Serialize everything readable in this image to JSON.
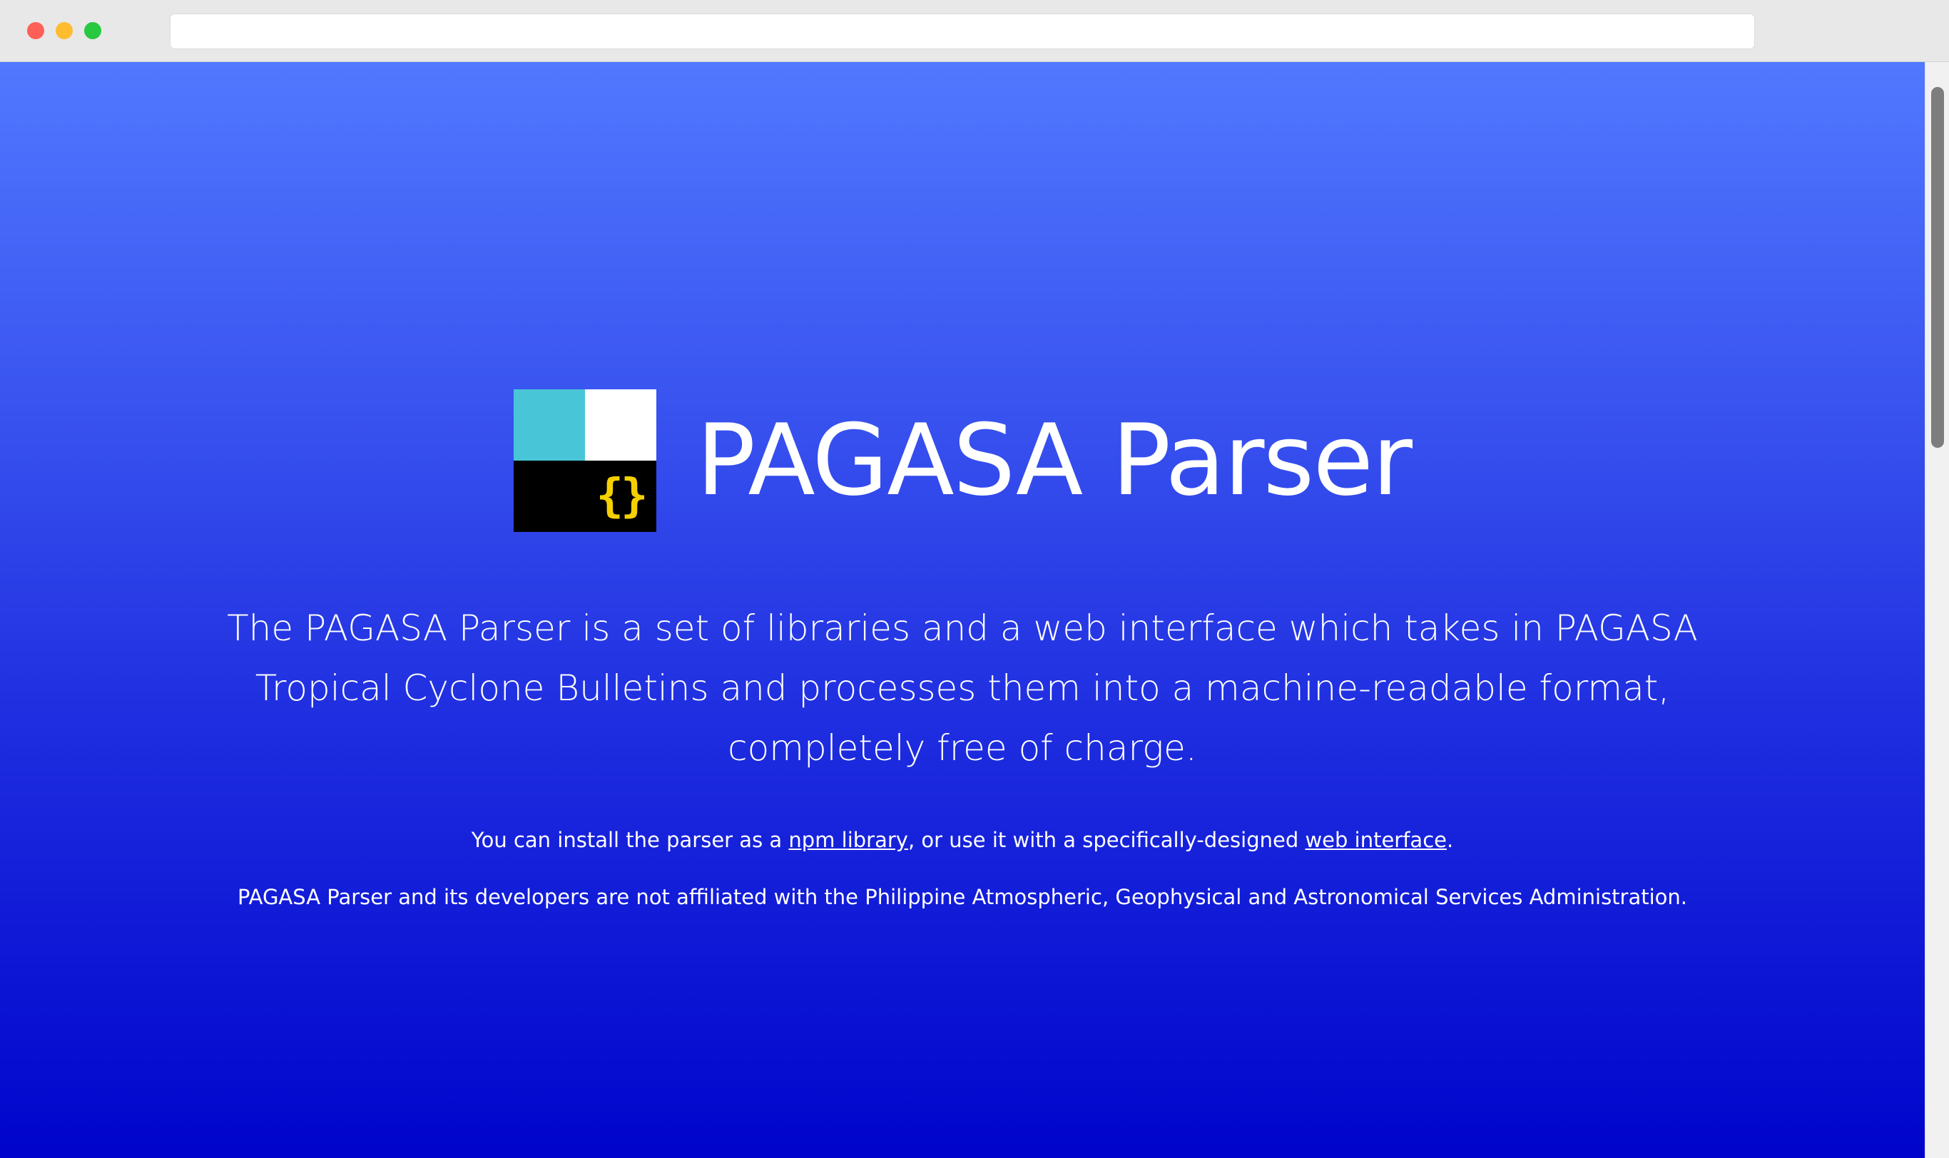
{
  "browser": {
    "address_value": ""
  },
  "hero": {
    "logo_glyph": "{}",
    "title": "PAGASA Parser"
  },
  "content": {
    "description": "The PAGASA Parser is a set of libraries and a web interface which takes in PAGASA Tropical Cyclone Bulletins and processes them into a machine-readable format, completely free of charge.",
    "install_prefix": "You can install the parser as a ",
    "npm_link": "npm library",
    "install_middle": ", or use it with a specifically-designed ",
    "web_link": "web interface",
    "install_suffix": ".",
    "disclaimer": "PAGASA Parser and its developers are not affiliated with the Philippine Atmospheric, Geophysical and Astronomical Services Administration."
  },
  "colors": {
    "gradient_top": "#5178ff",
    "gradient_bottom": "#0004cc",
    "logo_teal": "#48c5d6",
    "logo_white": "#ffffff",
    "logo_black": "#000000",
    "logo_braces": "#f5d000"
  }
}
